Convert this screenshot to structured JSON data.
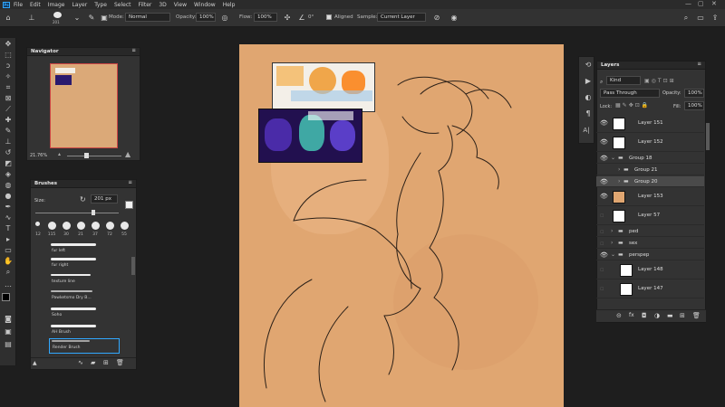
{
  "menubar": {
    "logo": "Ps",
    "items": [
      "File",
      "Edit",
      "Image",
      "Layer",
      "Type",
      "Select",
      "Filter",
      "3D",
      "View",
      "Window",
      "Help"
    ]
  },
  "options": {
    "brush_size": "201",
    "mode_label": "Mode:",
    "mode_value": "Normal",
    "opacity_label": "Opacity:",
    "opacity_value": "100%",
    "flow_label": "Flow:",
    "flow_value": "100%",
    "angle_value": "0°",
    "aligned_label": "Aligned",
    "sample_label": "Sample:",
    "sample_value": "Current Layer"
  },
  "navigator": {
    "title": "Navigator",
    "zoom": "21.76%"
  },
  "brushes": {
    "title": "Brushes",
    "size_label": "Size:",
    "size_value": "201 px",
    "tip_sizes": [
      "12",
      "115",
      "30",
      "21",
      "37",
      "72",
      "55"
    ],
    "list": [
      "fur left",
      "fur right",
      "texture line",
      "Pawketsmo Dry B...",
      "Soho",
      "AH Brush",
      "Render Brush"
    ]
  },
  "layers": {
    "title": "Layers",
    "filter_label": "Kind",
    "blend_mode": "Pass Through",
    "opacity_label": "Opacity:",
    "opacity_value": "100%",
    "lock_label": "Lock:",
    "fill_label": "Fill:",
    "fill_value": "100%",
    "rows": [
      {
        "name": "Layer 151",
        "type": "layer",
        "visible": true
      },
      {
        "name": "Layer 152",
        "type": "layer",
        "visible": true
      },
      {
        "name": "Group 18",
        "type": "group",
        "visible": true
      },
      {
        "name": "Group 21",
        "type": "group",
        "visible": true
      },
      {
        "name": "Group 20",
        "type": "group",
        "visible": true
      },
      {
        "name": "Layer 153",
        "type": "layer",
        "visible": true
      },
      {
        "name": "Layer 57",
        "type": "layer",
        "visible": false
      },
      {
        "name": "ped",
        "type": "group",
        "visible": false
      },
      {
        "name": "sex",
        "type": "group",
        "visible": false
      },
      {
        "name": "perspep",
        "type": "group",
        "visible": true
      },
      {
        "name": "Layer 148",
        "type": "layer",
        "visible": false
      },
      {
        "name": "Layer 147",
        "type": "layer",
        "visible": false
      }
    ]
  },
  "colors": {
    "canvas": "#e0a671",
    "panel": "#333333",
    "accent": "#31a8ff"
  }
}
